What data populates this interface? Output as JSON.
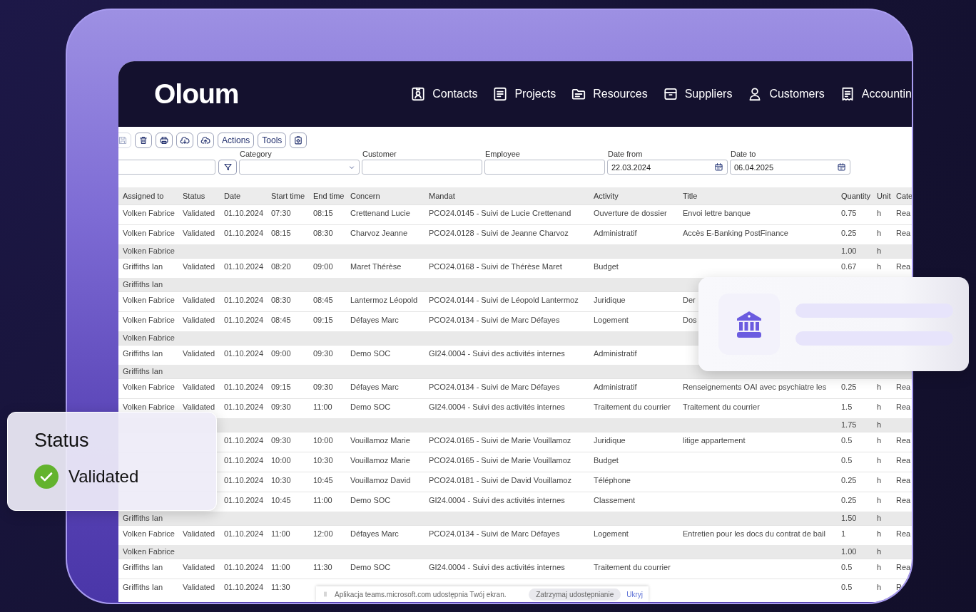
{
  "nav": {
    "logo": "Oloum",
    "items": [
      {
        "label": "Contacts"
      },
      {
        "label": "Projects"
      },
      {
        "label": "Resources"
      },
      {
        "label": "Suppliers"
      },
      {
        "label": "Customers"
      },
      {
        "label": "Accountin"
      }
    ]
  },
  "toolbar": [
    {
      "kind": "icon",
      "disabled": true
    },
    {
      "kind": "icon",
      "disabled": false
    },
    {
      "kind": "icon",
      "disabled": false
    },
    {
      "kind": "icon",
      "disabled": false
    },
    {
      "kind": "icon",
      "disabled": false
    },
    {
      "kind": "text",
      "label": "Actions",
      "disabled": false
    },
    {
      "kind": "text",
      "label": "Tools",
      "disabled": false
    },
    {
      "kind": "icon",
      "disabled": false
    }
  ],
  "filters": [
    {
      "kind": "text"
    },
    {
      "kind": "filter"
    },
    {
      "kind": "select",
      "label": "Category"
    },
    {
      "kind": "text",
      "label": "Customer"
    },
    {
      "kind": "text",
      "label": "Employee"
    },
    {
      "kind": "date",
      "label": "Date from",
      "value": "22.03.2024"
    },
    {
      "kind": "date",
      "label": "Date to",
      "value": "06.04.2025"
    }
  ],
  "table": {
    "columns": [
      "Assigned to",
      "Status",
      "Date",
      "Start time",
      "End time",
      "Concern",
      "Mandat",
      "Activity",
      "Title",
      "Quantity",
      "Unit",
      "Cate"
    ],
    "rows": [
      {
        "kind": "data",
        "cells": [
          "Volken Fabrice",
          "Validated",
          "01.10.2024",
          "07:30",
          "08:15",
          "Crettenand Lucie",
          "PCO24.0145 - Suivi de Lucie Crettenand",
          "Ouverture de dossier",
          "Envoi lettre banque",
          "0.75",
          "h",
          "Rea"
        ]
      },
      {
        "kind": "data",
        "cells": [
          "Volken Fabrice",
          "Validated",
          "01.10.2024",
          "08:15",
          "08:30",
          "Charvoz Jeanne",
          "PCO24.0128 - Suivi de Jeanne Charvoz",
          "Administratif",
          "Accès E-Banking PostFinance",
          "0.25",
          "h",
          "Rea"
        ]
      },
      {
        "kind": "group",
        "cells": [
          "Volken Fabrice",
          null,
          null,
          null,
          null,
          null,
          null,
          null,
          null,
          "1.00",
          "h",
          null
        ]
      },
      {
        "kind": "data",
        "cells": [
          "Griffiths Ian",
          "Validated",
          "01.10.2024",
          "08:20",
          "09:00",
          "Maret Thérèse",
          "PCO24.0168 - Suivi de Thérèse Maret",
          "Budget",
          null,
          "0.67",
          "h",
          "Rea"
        ]
      },
      {
        "kind": "group",
        "cells": [
          "Griffiths Ian",
          null,
          null,
          null,
          null,
          null,
          null,
          null,
          null,
          null,
          null,
          null
        ]
      },
      {
        "kind": "data",
        "cells": [
          "Volken Fabrice",
          "Validated",
          "01.10.2024",
          "08:30",
          "08:45",
          "Lantermoz Léopold",
          "PCO24.0144 - Suivi de Léopold Lantermoz",
          "Juridique",
          "Der",
          null,
          null,
          null
        ]
      },
      {
        "kind": "data",
        "cells": [
          "Volken Fabrice",
          "Validated",
          "01.10.2024",
          "08:45",
          "09:15",
          "Défayes Marc",
          "PCO24.0134 - Suivi de Marc Défayes",
          "Logement",
          "Dos",
          null,
          null,
          null
        ]
      },
      {
        "kind": "group",
        "cells": [
          "Volken Fabrice",
          null,
          null,
          null,
          null,
          null,
          null,
          null,
          null,
          null,
          null,
          null
        ]
      },
      {
        "kind": "data",
        "cells": [
          "Griffiths Ian",
          "Validated",
          "01.10.2024",
          "09:00",
          "09:30",
          "Demo SOC",
          "GI24.0004 - Suivi des activités internes",
          "Administratif",
          null,
          null,
          null,
          null
        ]
      },
      {
        "kind": "group",
        "cells": [
          "Griffiths Ian",
          null,
          null,
          null,
          null,
          null,
          null,
          null,
          null,
          null,
          null,
          null
        ]
      },
      {
        "kind": "data",
        "cells": [
          "Volken Fabrice",
          "Validated",
          "01.10.2024",
          "09:15",
          "09:30",
          "Défayes Marc",
          "PCO24.0134 - Suivi de Marc Défayes",
          "Administratif",
          "Renseignements OAI avec psychiatre les",
          "0.25",
          "h",
          "Rea"
        ]
      },
      {
        "kind": "data",
        "cells": [
          "Volken Fabrice",
          "Validated",
          "01.10.2024",
          "09:30",
          "11:00",
          "Demo SOC",
          "GI24.0004 - Suivi des activités internes",
          "Traitement du courrier",
          "Traitement du courrier",
          "1.5",
          "h",
          "Rea"
        ]
      },
      {
        "kind": "group",
        "cells": [
          null,
          null,
          null,
          null,
          null,
          null,
          null,
          null,
          null,
          "1.75",
          "h",
          null
        ]
      },
      {
        "kind": "data",
        "cells": [
          null,
          null,
          "01.10.2024",
          "09:30",
          "10:00",
          "Vouillamoz Marie",
          "PCO24.0165 - Suivi de Marie Vouillamoz",
          "Juridique",
          "litige appartement",
          "0.5",
          "h",
          "Rea"
        ]
      },
      {
        "kind": "data",
        "cells": [
          null,
          null,
          "01.10.2024",
          "10:00",
          "10:30",
          "Vouillamoz Marie",
          "PCO24.0165 - Suivi de Marie Vouillamoz",
          "Budget",
          null,
          "0.5",
          "h",
          "Rea"
        ]
      },
      {
        "kind": "data",
        "cells": [
          null,
          null,
          "01.10.2024",
          "10:30",
          "10:45",
          "Vouillamoz David",
          "PCO24.0181 - Suivi de David Vouillamoz",
          "Téléphone",
          null,
          "0.25",
          "h",
          "Rea"
        ]
      },
      {
        "kind": "data",
        "cells": [
          null,
          null,
          "01.10.2024",
          "10:45",
          "11:00",
          "Demo SOC",
          "GI24.0004 - Suivi des activités internes",
          "Classement",
          null,
          "0.25",
          "h",
          "Rea"
        ]
      },
      {
        "kind": "group",
        "cells": [
          "Griffiths Ian",
          null,
          null,
          null,
          null,
          null,
          null,
          null,
          null,
          "1.50",
          "h",
          null
        ]
      },
      {
        "kind": "data",
        "cells": [
          "Volken Fabrice",
          "Validated",
          "01.10.2024",
          "11:00",
          "12:00",
          "Défayes Marc",
          "PCO24.0134 - Suivi de Marc Défayes",
          "Logement",
          "Entretien pour les docs du contrat de bail",
          "1",
          "h",
          "Rea"
        ]
      },
      {
        "kind": "group",
        "cells": [
          "Volken Fabrice",
          null,
          null,
          null,
          null,
          null,
          null,
          null,
          null,
          "1.00",
          "h",
          null
        ]
      },
      {
        "kind": "data",
        "cells": [
          "Griffiths Ian",
          "Validated",
          "01.10.2024",
          "11:00",
          "11:30",
          "Demo SOC",
          "GI24.0004 - Suivi des activités internes",
          "Traitement du courrier",
          null,
          "0.5",
          "h",
          "Rea"
        ]
      },
      {
        "kind": "data",
        "cells": [
          "Griffiths Ian",
          "Validated",
          "01.10.2024",
          "11:30",
          null,
          null,
          null,
          null,
          null,
          "0.5",
          "h",
          "R"
        ]
      }
    ]
  },
  "share_bar": {
    "message": "Aplikacja teams.microsoft.com udostępnia Twój ekran.",
    "stop_button": "Zatrzymaj udostępnianie",
    "hide_link": "Ukryj"
  },
  "status_card": {
    "title": "Status",
    "value": "Validated"
  }
}
